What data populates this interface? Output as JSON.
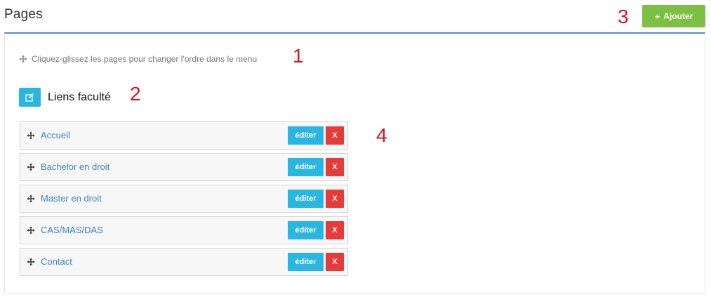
{
  "header": {
    "title": "Pages",
    "add_button_icon": "plus-icon",
    "add_button_label": "Ajouter"
  },
  "hint": {
    "icon": "move-icon",
    "text": "Cliquez-glissez les pages pour changer l'ordre dans le menu"
  },
  "menu": {
    "edit_icon": "pencil-square-icon",
    "title": "Liens faculté"
  },
  "pages": [
    {
      "label": "Accueil",
      "edit_label": "éditer",
      "delete_label": "X"
    },
    {
      "label": "Bachelor en droit",
      "edit_label": "éditer",
      "delete_label": "X"
    },
    {
      "label": "Master en droit",
      "edit_label": "éditer",
      "delete_label": "X"
    },
    {
      "label": "CAS/MAS/DAS",
      "edit_label": "éditer",
      "delete_label": "X"
    },
    {
      "label": "Contact",
      "edit_label": "éditer",
      "delete_label": "X"
    }
  ],
  "annotations": [
    "1",
    "2",
    "3",
    "4"
  ],
  "colors": {
    "accent_blue": "#29b6e0",
    "add_green": "#7bc043",
    "delete_red": "#e63b3b",
    "link_blue": "#3d82c4",
    "panel_top_border": "#4a90d9",
    "annotation_red": "#d0161c"
  }
}
